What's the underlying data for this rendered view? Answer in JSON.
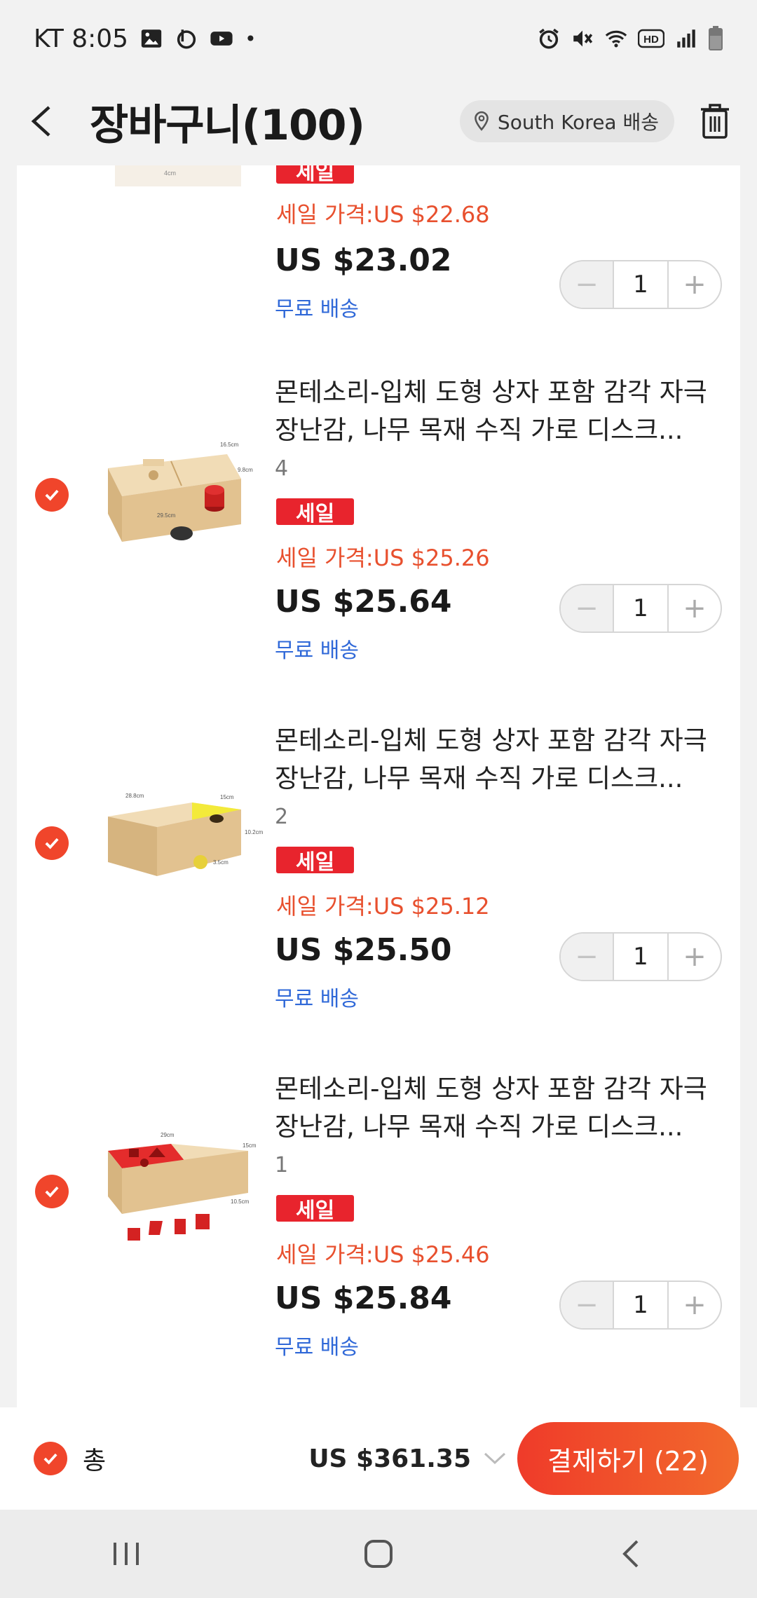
{
  "status_bar": {
    "carrier_time": "KT 8:05",
    "dot": "•",
    "left_icons": [
      "gallery-icon",
      "b-app-icon",
      "youtube-icon"
    ],
    "right_icons": [
      "alarm-icon",
      "mute-icon",
      "wifi-icon",
      "hd-icon",
      "signal-icon",
      "battery-icon"
    ]
  },
  "header": {
    "title": "장바구니(100)",
    "ship_to": "South Korea 배송"
  },
  "items": [
    {
      "title": "",
      "variant": "",
      "badge": "세일",
      "sale_price": "세일 가격:US $22.68",
      "price": "US $23.02",
      "shipping": "무료 배송",
      "quantity": "1",
      "checked": true
    },
    {
      "title": "몬테소리-입체 도형 상자 포함 감각 자극 장난감, 나무 목재 수직 가로 디스크...",
      "variant": "4",
      "badge": "세일",
      "sale_price": "세일 가격:US $25.26",
      "price": "US $25.64",
      "shipping": "무료 배송",
      "quantity": "1",
      "checked": true,
      "thumb_colors": {
        "box": "#e9cfa2",
        "lid": "#f1dcb6",
        "accent": "#c8201f"
      }
    },
    {
      "title": "몬테소리-입체 도형 상자 포함 감각 자극 장난감, 나무 목재 수직 가로 디스크...",
      "variant": "2",
      "badge": "세일",
      "sale_price": "세일 가격:US $25.12",
      "price": "US $25.50",
      "shipping": "무료 배송",
      "quantity": "1",
      "checked": true,
      "thumb_colors": {
        "box": "#e9cfa2",
        "lid": "#f3ea3a",
        "accent": "#e7d03a"
      }
    },
    {
      "title": "몬테소리-입체 도형 상자 포함 감각 자극 장난감, 나무 목재 수직 가로 디스크...",
      "variant": "1",
      "badge": "세일",
      "sale_price": "세일 가격:US $25.46",
      "price": "US $25.84",
      "shipping": "무료 배송",
      "quantity": "1",
      "checked": true,
      "thumb_colors": {
        "box": "#e9cfa2",
        "lid": "#e42c2c",
        "accent": "#d42222"
      }
    }
  ],
  "summary": {
    "label": "총",
    "total": "US $361.35",
    "checkout_label": "결제하기 (22)",
    "checked": true
  },
  "colors": {
    "accent": "#f0452b",
    "sale_badge": "#e8242d",
    "sale_price": "#e8502e",
    "shipping_link": "#2f68d8"
  }
}
